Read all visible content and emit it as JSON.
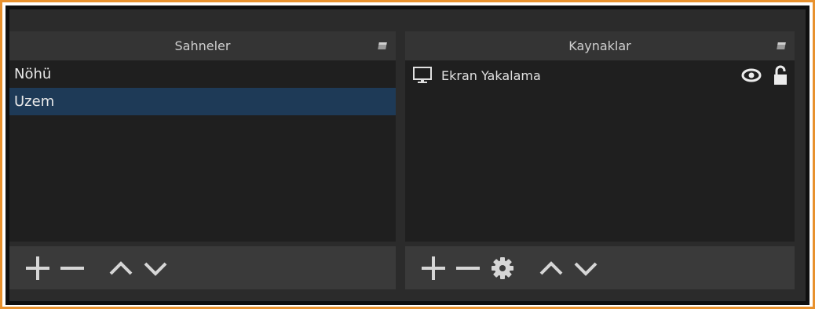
{
  "scenes": {
    "title": "Sahneler",
    "items": [
      {
        "label": "Nöhü",
        "selected": false
      },
      {
        "label": "Uzem",
        "selected": true
      }
    ]
  },
  "sources": {
    "title": "Kaynaklar",
    "items": [
      {
        "label": "Ekran Yakalama",
        "icon": "monitor-icon",
        "visible": true,
        "locked": false
      }
    ]
  },
  "colors": {
    "accent_border": "#e8912d",
    "selection": "#1e3a57",
    "panel_bg": "#1f1f1f"
  },
  "toolbar_icons": {
    "scenes": [
      "plus-icon",
      "minus-icon",
      "up-arrow-icon",
      "down-arrow-icon"
    ],
    "sources": [
      "plus-icon",
      "minus-icon",
      "gear-icon",
      "up-arrow-icon",
      "down-arrow-icon"
    ]
  }
}
